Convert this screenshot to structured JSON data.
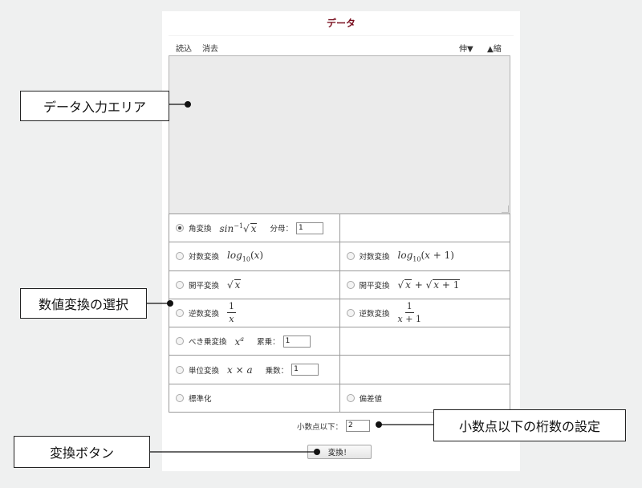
{
  "panel": {
    "title": "データ",
    "toolbar": {
      "load": "読込",
      "clear": "消去",
      "expand": "伸▼",
      "shrink": "▲縮"
    }
  },
  "options": {
    "angle": {
      "label": "角変換",
      "field_label": "分母：",
      "field_value": "1",
      "selected": true
    },
    "log_left": {
      "label": "対数変換"
    },
    "log_right": {
      "label": "対数変換"
    },
    "sqrt_left": {
      "label": "開平変換"
    },
    "sqrt_right": {
      "label": "開平変換"
    },
    "inv_left": {
      "label": "逆数変換"
    },
    "inv_right": {
      "label": "逆数変換"
    },
    "power": {
      "label": "べき乗変換",
      "field_label": "累乗：",
      "field_value": "1"
    },
    "unit": {
      "label": "単位変換",
      "field_label": "乗数：",
      "field_value": "1"
    },
    "standardize": {
      "label": "標準化"
    },
    "deviation": {
      "label": "偏差値"
    }
  },
  "decimals": {
    "label": "小数点以下：",
    "value": "2"
  },
  "convert_button": "変換！",
  "callouts": {
    "data_area": "データ入力エリア",
    "selection": "数値変換の選択",
    "decimals": "小数点以下の桁数の設定",
    "button": "変換ボタン"
  }
}
